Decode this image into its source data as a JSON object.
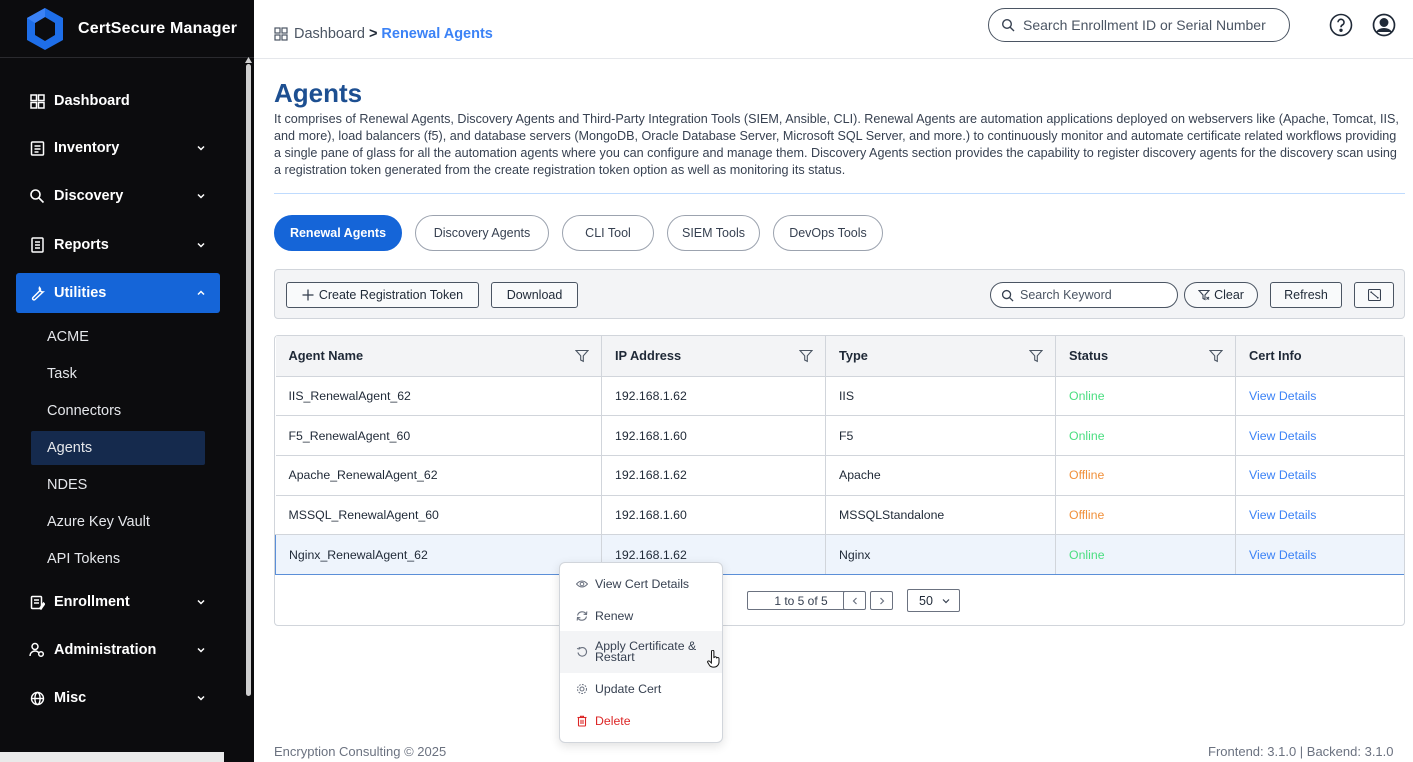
{
  "app": {
    "name": "CertSecure Manager"
  },
  "sidebar": {
    "items": [
      {
        "label": "Dashboard",
        "icon": "dashboard-icon"
      },
      {
        "label": "Inventory",
        "icon": "clipboard-icon"
      },
      {
        "label": "Discovery",
        "icon": "search-icon"
      },
      {
        "label": "Reports",
        "icon": "report-icon"
      },
      {
        "label": "Utilities",
        "icon": "wrench-icon"
      },
      {
        "label": "Enrollment",
        "icon": "form-icon"
      },
      {
        "label": "Administration",
        "icon": "admin-icon"
      },
      {
        "label": "Misc",
        "icon": "globe-icon"
      }
    ],
    "utilities_sub": [
      "ACME",
      "Task",
      "Connectors",
      "Agents",
      "NDES",
      "Azure Key Vault",
      "API Tokens"
    ],
    "active_item": "Utilities",
    "active_sub": "Agents"
  },
  "topbar": {
    "breadcrumb_home": "Dashboard",
    "breadcrumb_sep": ">",
    "breadcrumb_current": "Renewal Agents",
    "search_placeholder": "Search Enrollment ID or Serial Number"
  },
  "page": {
    "title": "Agents",
    "description": "It comprises of Renewal Agents, Discovery Agents and Third-Party Integration Tools (SIEM, Ansible, CLI). Renewal Agents are automation applications deployed on webservers like (Apache, Tomcat, IIS, and more), load balancers (f5), and database servers (MongoDB, Oracle Database Server, Microsoft SQL Server, and more.) to continuously monitor and automate certificate related workflows providing a single pane of glass for all the automation agents where you can configure and manage them. Discovery Agents section provides the capability to register discovery agents for the discovery scan using a registration token generated from the create registration token option as well as monitoring its status."
  },
  "tabs": [
    "Renewal Agents",
    "Discovery Agents",
    "CLI Tool",
    "SIEM Tools",
    "DevOps Tools"
  ],
  "toolbar": {
    "create_label": "Create Registration Token",
    "download_label": "Download",
    "search_placeholder": "Search Keyword",
    "clear_label": "Clear",
    "refresh_label": "Refresh"
  },
  "table": {
    "columns": [
      "Agent Name",
      "IP Address",
      "Type",
      "Status",
      "Cert Info"
    ],
    "rows": [
      {
        "name": "IIS_RenewalAgent_62",
        "ip": "192.168.1.62",
        "type": "IIS",
        "status": "Online",
        "cert": "View Details"
      },
      {
        "name": "F5_RenewalAgent_60",
        "ip": "192.168.1.60",
        "type": "F5",
        "status": "Online",
        "cert": "View Details"
      },
      {
        "name": "Apache_RenewalAgent_62",
        "ip": "192.168.1.62",
        "type": "Apache",
        "status": "Offline",
        "cert": "View Details"
      },
      {
        "name": "MSSQL_RenewalAgent_60",
        "ip": "192.168.1.60",
        "type": "MSSQLStandalone",
        "status": "Offline",
        "cert": "View Details"
      },
      {
        "name": "Nginx_RenewalAgent_62",
        "ip": "192.168.1.62",
        "type": "Nginx",
        "status": "Online",
        "cert": "View Details"
      }
    ],
    "selected_row": "Nginx_RenewalAgent_62"
  },
  "pagination": {
    "info": "1 to 5 of 5",
    "page_size": "50"
  },
  "context_menu": {
    "view_cert": "View Cert Details",
    "renew": "Renew",
    "apply_line1": "Apply Certificate &",
    "apply_line2": "Restart",
    "update": "Update Cert",
    "delete": "Delete"
  },
  "footer": {
    "copyright": "Encryption Consulting © 2025",
    "version": "Frontend: 3.1.0  |  Backend: 3.1.0"
  },
  "colors": {
    "accent": "#1565d8",
    "title": "#1d4f91",
    "online": "#4ade80",
    "offline": "#f0903a",
    "link": "#3b82f6",
    "sidebar_bg": "#0c0c0e"
  }
}
